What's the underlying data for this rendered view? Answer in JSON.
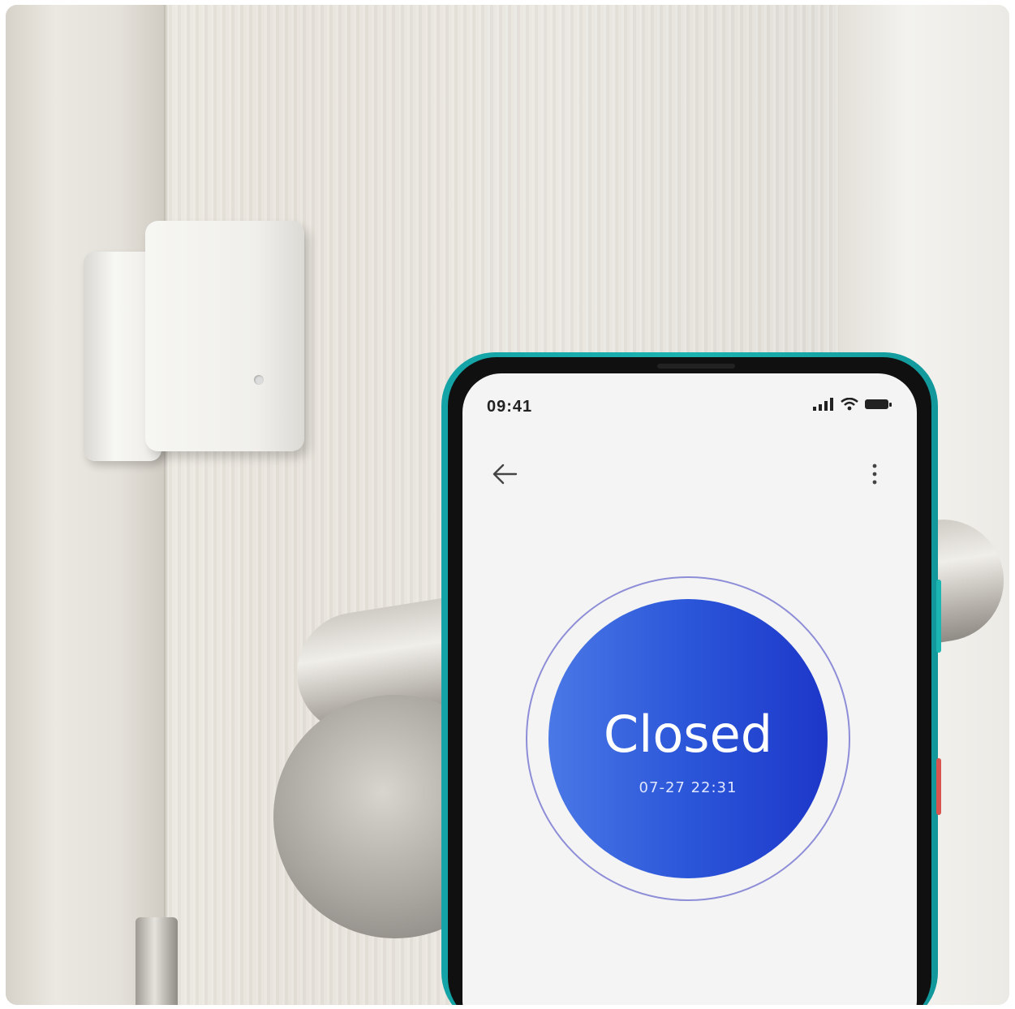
{
  "status_bar": {
    "time": "09:41",
    "icons": [
      "signal-icon",
      "wifi-icon",
      "battery-icon"
    ]
  },
  "toolbar": {
    "back_icon": "arrow-left-icon",
    "menu_icon": "more-vertical-icon"
  },
  "sensor_state": {
    "label": "Closed",
    "timestamp": "07-27 22:31"
  },
  "colors": {
    "phone_frame": "#17a7a9",
    "state_circle_start": "#4a78e6",
    "state_circle_end": "#1d37c9",
    "ring": "#8d8dd8",
    "screen_bg": "#f4f4f4"
  }
}
